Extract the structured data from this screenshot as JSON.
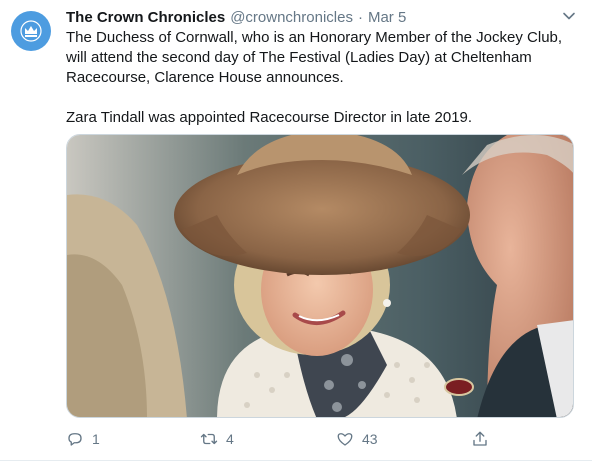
{
  "tweet": {
    "display_name": "The Crown Chronicles",
    "handle": "@crownchronicles",
    "separator": "·",
    "date": "Mar 5",
    "text_paragraph_1": "The Duchess of Cornwall, who is an Honorary Member of the Jockey Club, will attend the second day of The Festival (Ladies Day) at Cheltenham Racecourse, Clarence House announces.",
    "text_paragraph_2": "Zara Tindall was appointed Racecourse Director in late 2019.",
    "avatar_icon": "crown-icon",
    "avatar_color": "#4d9ce0",
    "media_description_icon": "photo"
  },
  "actions": {
    "reply_count": "1",
    "retweet_count": "4",
    "like_count": "43"
  },
  "colors": {
    "text_primary": "#14171a",
    "text_secondary": "#657786",
    "border": "#ccd6dd"
  }
}
